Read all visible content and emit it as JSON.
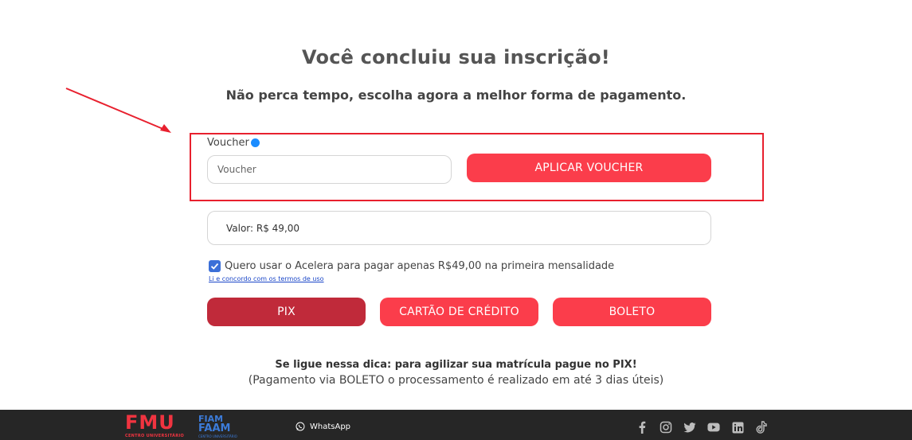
{
  "header": {
    "title": "Você concluiu sua inscrição!",
    "subtitle": "Não perca tempo, escolha agora a melhor forma de pagamento."
  },
  "voucher": {
    "label": "Voucher",
    "placeholder": "Voucher",
    "value": "",
    "apply_label": "APLICAR VOUCHER"
  },
  "valor": {
    "text": "Valor: R$ 49,00"
  },
  "acelera": {
    "checked": true,
    "label": "Quero usar o Acelera para pagar apenas R$49,00 na primeira mensalidade",
    "terms_link": "Li e concordo com os termos de uso"
  },
  "payment": {
    "pix_label": "PIX",
    "card_label": "CARTÃO DE CRÉDITO",
    "boleto_label": "BOLETO"
  },
  "tip": {
    "strong": "Se ligue nessa dica: para agilizar sua matrícula pague no PIX!",
    "note": "(Pagamento via BOLETO o processamento é realizado em até 3 dias úteis)"
  },
  "footer": {
    "fmu_logo": "FMU",
    "fmu_sub": "CENTRO UNIVERSITÁRIO",
    "fiam_logo": "FIAM",
    "faam_logo": "FAAM",
    "faam_sub": "CENTRO UNIVERSITÁRIO",
    "whatsapp_label": "WhatsApp",
    "social_icons": [
      "facebook-icon",
      "instagram-icon",
      "twitter-icon",
      "youtube-icon",
      "linkedin-icon",
      "tiktok-icon"
    ]
  },
  "colors": {
    "primary_red": "#fb3d4b",
    "pix_selected": "#c02a3a",
    "highlight_border": "#e8202e",
    "footer_bg": "#262626",
    "checkbox": "#3b6fd8"
  }
}
